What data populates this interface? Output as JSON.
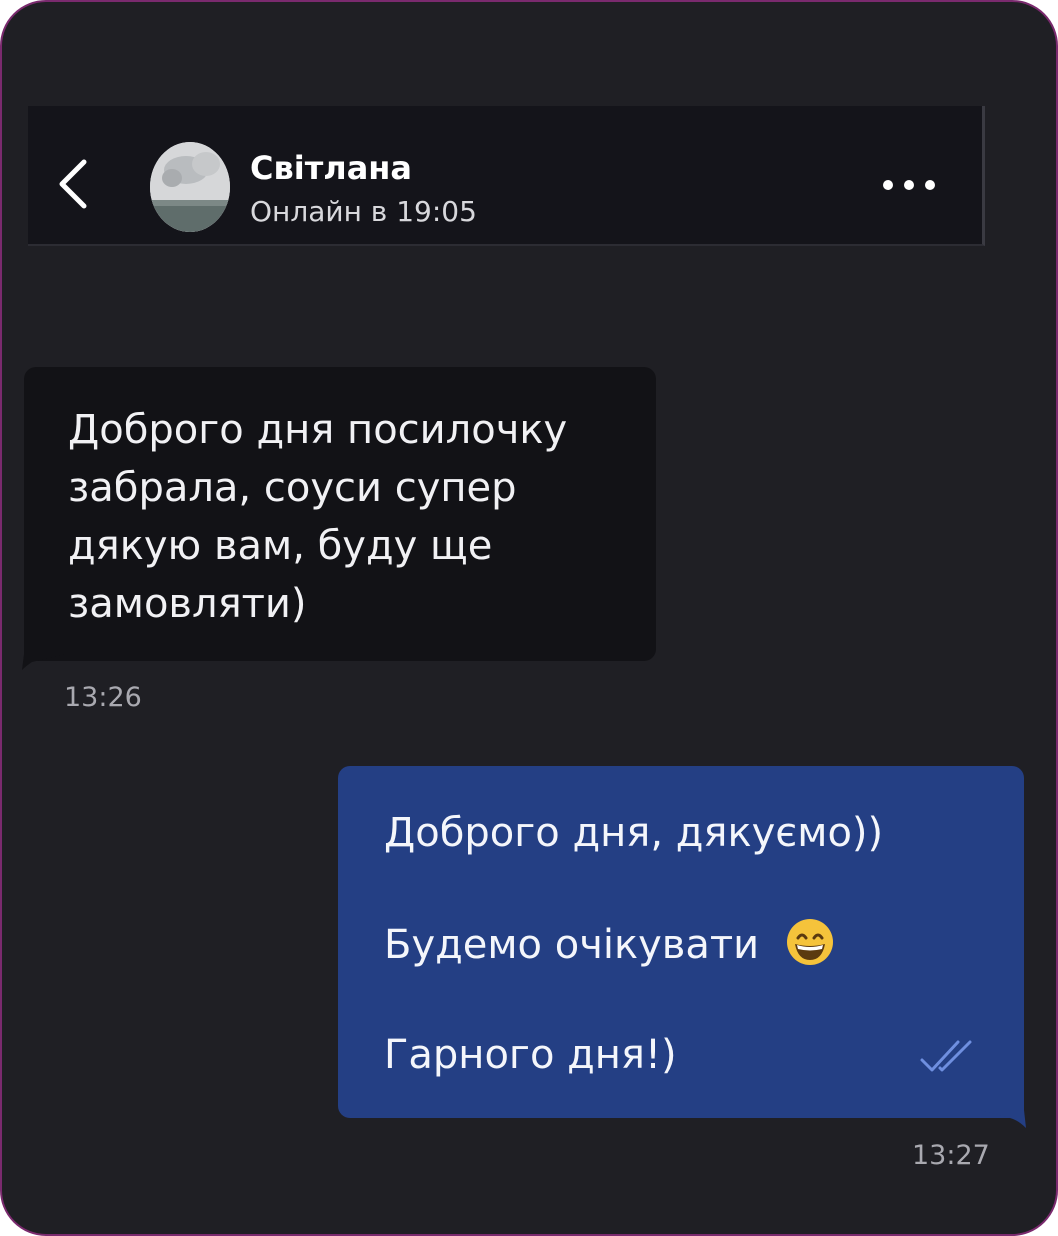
{
  "header": {
    "contact_name": "Світлана",
    "status": "Онлайн в 19:05",
    "back_icon": "chevron-left-icon",
    "more_icon": "more-horizontal-icon"
  },
  "messages": [
    {
      "direction": "incoming",
      "text": "Доброго дня посилочку забрала, соуси супер дякую вам, буду ще замовляти)",
      "time": "13:26"
    },
    {
      "direction": "outgoing",
      "lines": [
        "Доброго дня, дякуємо))",
        "Будемо очікувати",
        "Гарного дня!)"
      ],
      "emoji": "grinning-face-icon",
      "status_icon": "double-check-icon",
      "time": "13:27"
    }
  ],
  "colors": {
    "background": "#1f1f24",
    "header": "#14141a",
    "incoming_bubble": "#121216",
    "outgoing_bubble": "#243f84",
    "frame_border": "#7a2a6e",
    "read_ticks": "#6f8fe0"
  }
}
